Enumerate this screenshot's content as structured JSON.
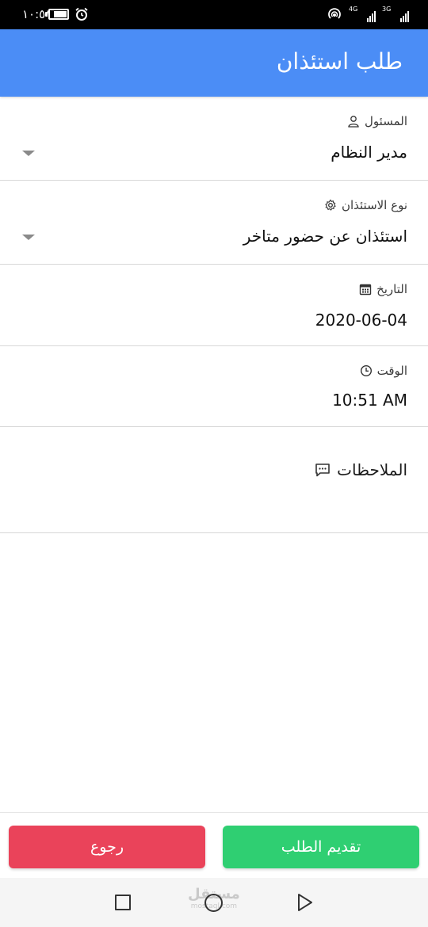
{
  "status_bar": {
    "time": "١٠:٥١",
    "net_4g": "4G",
    "net_3g": "3G"
  },
  "app_bar": {
    "title": "طلب استئذان"
  },
  "form": {
    "responsible": {
      "label": "المسئول",
      "value": "مدير النظام",
      "icon": "person-icon"
    },
    "leave_type": {
      "label": "نوع الاستئذان",
      "value": "استئذان عن حضور متاخر",
      "icon": "gear-icon"
    },
    "date": {
      "label": "التاريخ",
      "value": "2020-06-04",
      "icon": "calendar-icon"
    },
    "time": {
      "label": "الوقت",
      "value": "10:51 AM",
      "icon": "clock-icon"
    },
    "notes": {
      "placeholder": "الملاحظات",
      "icon": "chat-icon"
    }
  },
  "actions": {
    "submit_label": "تقديم الطلب",
    "back_label": "رجوع",
    "submit_color": "#2fcf72",
    "back_color": "#ea435a"
  },
  "watermark": {
    "text": "مستقل",
    "sub": "mostaql.com"
  },
  "theme": {
    "primary": "#4b8df6"
  }
}
